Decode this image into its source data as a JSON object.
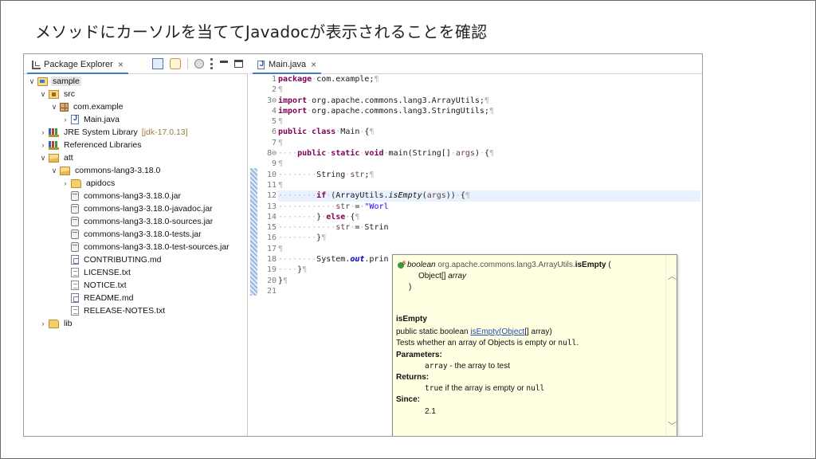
{
  "slide": {
    "title": "メソッドにカーソルを当ててJavadocが表示されることを確認"
  },
  "explorer": {
    "tab_label": "Package Explorer",
    "close_glyph": "×",
    "tree": [
      {
        "label": "sample",
        "icon": "project-icon",
        "depth": 0,
        "expanded": true,
        "selected": true
      },
      {
        "label": "src",
        "icon": "source-folder-icon",
        "depth": 1,
        "expanded": true
      },
      {
        "label": "com.example",
        "icon": "package-icon",
        "depth": 2,
        "expanded": true
      },
      {
        "label": "Main.java",
        "icon": "java-file-icon",
        "depth": 3,
        "expanded": false
      },
      {
        "label": "JRE System Library",
        "decoration": "[jdk-17.0.13]",
        "icon": "library-icon",
        "depth": 1,
        "expanded": false
      },
      {
        "label": "Referenced Libraries",
        "icon": "library-icon",
        "depth": 1,
        "expanded": false
      },
      {
        "label": "att",
        "icon": "open-folder-icon",
        "depth": 1,
        "expanded": true
      },
      {
        "label": "commons-lang3-3.18.0",
        "icon": "open-folder-icon",
        "depth": 2,
        "expanded": true
      },
      {
        "label": "apidocs",
        "icon": "folder-icon",
        "depth": 3,
        "expanded": false
      },
      {
        "label": "commons-lang3-3.18.0.jar",
        "icon": "jar-icon",
        "depth": 3
      },
      {
        "label": "commons-lang3-3.18.0-javadoc.jar",
        "icon": "jar-icon",
        "depth": 3
      },
      {
        "label": "commons-lang3-3.18.0-sources.jar",
        "icon": "jar-icon",
        "depth": 3
      },
      {
        "label": "commons-lang3-3.18.0-tests.jar",
        "icon": "jar-icon",
        "depth": 3
      },
      {
        "label": "commons-lang3-3.18.0-test-sources.jar",
        "icon": "jar-icon",
        "depth": 3
      },
      {
        "label": "CONTRIBUTING.md",
        "icon": "markdown-file-icon",
        "depth": 3
      },
      {
        "label": "LICENSE.txt",
        "icon": "text-file-icon",
        "depth": 3
      },
      {
        "label": "NOTICE.txt",
        "icon": "text-file-icon",
        "depth": 3
      },
      {
        "label": "README.md",
        "icon": "markdown-file-icon",
        "depth": 3
      },
      {
        "label": "RELEASE-NOTES.txt",
        "icon": "text-file-icon",
        "depth": 3
      },
      {
        "label": "lib",
        "icon": "folder-icon",
        "depth": 1,
        "expanded": false
      }
    ]
  },
  "editor": {
    "tab_label": "Main.java",
    "close_glyph": "×",
    "line_numbers": [
      "1",
      "2",
      "3⊖",
      "4",
      "5",
      "6",
      "7",
      "8⊖",
      "9",
      "10",
      "11",
      "12",
      "13",
      "14",
      "15",
      "16",
      "17",
      "18",
      "19",
      "20",
      "21"
    ],
    "code_lines": [
      [
        {
          "t": "kw",
          "v": "package"
        },
        {
          "t": "ws",
          "v": "·"
        },
        {
          "t": "p",
          "v": "com.example;"
        },
        {
          "t": "ws",
          "v": "¶"
        }
      ],
      [
        {
          "t": "ws",
          "v": "¶"
        }
      ],
      [
        {
          "t": "kw",
          "v": "import"
        },
        {
          "t": "ws",
          "v": "·"
        },
        {
          "t": "p",
          "v": "org.apache.commons.lang3.ArrayUtils;"
        },
        {
          "t": "ws",
          "v": "¶"
        }
      ],
      [
        {
          "t": "kw",
          "v": "import"
        },
        {
          "t": "ws",
          "v": "·"
        },
        {
          "t": "p",
          "v": "org.apache.commons.lang3.StringUtils;"
        },
        {
          "t": "ws",
          "v": "¶"
        }
      ],
      [
        {
          "t": "ws",
          "v": "¶"
        }
      ],
      [
        {
          "t": "kw",
          "v": "public"
        },
        {
          "t": "ws",
          "v": "·"
        },
        {
          "t": "kw",
          "v": "class"
        },
        {
          "t": "ws",
          "v": "·"
        },
        {
          "t": "p",
          "v": "Main"
        },
        {
          "t": "ws",
          "v": "·"
        },
        {
          "t": "p",
          "v": "{"
        },
        {
          "t": "ws",
          "v": "¶"
        }
      ],
      [
        {
          "t": "ws",
          "v": "¶"
        }
      ],
      [
        {
          "t": "ws",
          "v": "····"
        },
        {
          "t": "kw",
          "v": "public"
        },
        {
          "t": "ws",
          "v": "·"
        },
        {
          "t": "kw",
          "v": "static"
        },
        {
          "t": "ws",
          "v": "·"
        },
        {
          "t": "kw",
          "v": "void"
        },
        {
          "t": "ws",
          "v": "·"
        },
        {
          "t": "p",
          "v": "main(String[]"
        },
        {
          "t": "ws",
          "v": "·"
        },
        {
          "t": "var",
          "v": "args"
        },
        {
          "t": "p",
          "v": ")"
        },
        {
          "t": "ws",
          "v": "·"
        },
        {
          "t": "p",
          "v": "{"
        },
        {
          "t": "ws",
          "v": "¶"
        }
      ],
      [
        {
          "t": "ws",
          "v": "¶"
        }
      ],
      [
        {
          "t": "ws",
          "v": "········"
        },
        {
          "t": "p",
          "v": "String"
        },
        {
          "t": "ws",
          "v": "·"
        },
        {
          "t": "var",
          "v": "str"
        },
        {
          "t": "p",
          "v": ";"
        },
        {
          "t": "ws",
          "v": "¶"
        }
      ],
      [
        {
          "t": "ws",
          "v": "¶"
        }
      ],
      [
        {
          "t": "ws",
          "v": "········"
        },
        {
          "t": "kw",
          "v": "if"
        },
        {
          "t": "ws",
          "v": "·"
        },
        {
          "t": "p",
          "v": "(ArrayUtils."
        },
        {
          "t": "it",
          "v": "isEmpty"
        },
        {
          "t": "p",
          "v": "("
        },
        {
          "t": "var",
          "v": "args"
        },
        {
          "t": "p",
          "v": "))"
        },
        {
          "t": "ws",
          "v": "·"
        },
        {
          "t": "p",
          "v": "{"
        },
        {
          "t": "ws",
          "v": "¶"
        }
      ],
      [
        {
          "t": "ws",
          "v": "············"
        },
        {
          "t": "var",
          "v": "str"
        },
        {
          "t": "ws",
          "v": "·"
        },
        {
          "t": "p",
          "v": "="
        },
        {
          "t": "ws",
          "v": "·"
        },
        {
          "t": "str",
          "v": "\"Worl"
        }
      ],
      [
        {
          "t": "ws",
          "v": "········"
        },
        {
          "t": "p",
          "v": "}"
        },
        {
          "t": "ws",
          "v": "·"
        },
        {
          "t": "kw",
          "v": "else"
        },
        {
          "t": "ws",
          "v": "·"
        },
        {
          "t": "p",
          "v": "{"
        },
        {
          "t": "ws",
          "v": "¶"
        }
      ],
      [
        {
          "t": "ws",
          "v": "············"
        },
        {
          "t": "var",
          "v": "str"
        },
        {
          "t": "ws",
          "v": "·"
        },
        {
          "t": "p",
          "v": "="
        },
        {
          "t": "ws",
          "v": "·"
        },
        {
          "t": "p",
          "v": "Strin"
        }
      ],
      [
        {
          "t": "ws",
          "v": "········"
        },
        {
          "t": "p",
          "v": "}"
        },
        {
          "t": "ws",
          "v": "¶"
        }
      ],
      [
        {
          "t": "ws",
          "v": "¶"
        }
      ],
      [
        {
          "t": "ws",
          "v": "········"
        },
        {
          "t": "p",
          "v": "System."
        },
        {
          "t": "fld",
          "v": "out"
        },
        {
          "t": "p",
          "v": ".prin"
        }
      ],
      [
        {
          "t": "ws",
          "v": "····"
        },
        {
          "t": "p",
          "v": "}"
        },
        {
          "t": "ws",
          "v": "¶"
        }
      ],
      [
        {
          "t": "p",
          "v": "}"
        },
        {
          "t": "ws",
          "v": "¶"
        }
      ],
      []
    ],
    "current_line_index": 11
  },
  "javadoc": {
    "sig_return": "boolean",
    "sig_class": "org.apache.commons.lang3.ArrayUtils.",
    "sig_method": "isEmpty",
    "sig_open": " (",
    "sig_param_type": "Object[]",
    "sig_param_name": "array",
    "sig_close": ")",
    "heading": "isEmpty",
    "decl_prefix": "public static boolean ",
    "decl_link_method": "isEmpty",
    "decl_paren_open": "(",
    "decl_link_type": "Object",
    "decl_suffix": "[] array)",
    "desc_text": "Tests whether an array of Objects is empty or ",
    "desc_code": "null",
    "desc_end": ".",
    "params_label": "Parameters:",
    "param_name": "array",
    "param_desc": " - the array to test",
    "returns_label": "Returns:",
    "returns_code": "true",
    "returns_text": " if the array is empty or ",
    "returns_code2": "null",
    "since_label": "Since:",
    "since_value": "2.1"
  },
  "icons": {
    "vscroll_up": "︿",
    "vscroll_down": "﹀",
    "hscroll_left": "‹",
    "hscroll_right": "›",
    "back": "⇦",
    "forward": "⇨",
    "at": "@",
    "menu_caret": "▾"
  },
  "colors": {
    "keyword": "#7f0055",
    "string": "#2a00ff",
    "hover_bg": "#ffffe1",
    "current_line": "#e8f2fe"
  }
}
